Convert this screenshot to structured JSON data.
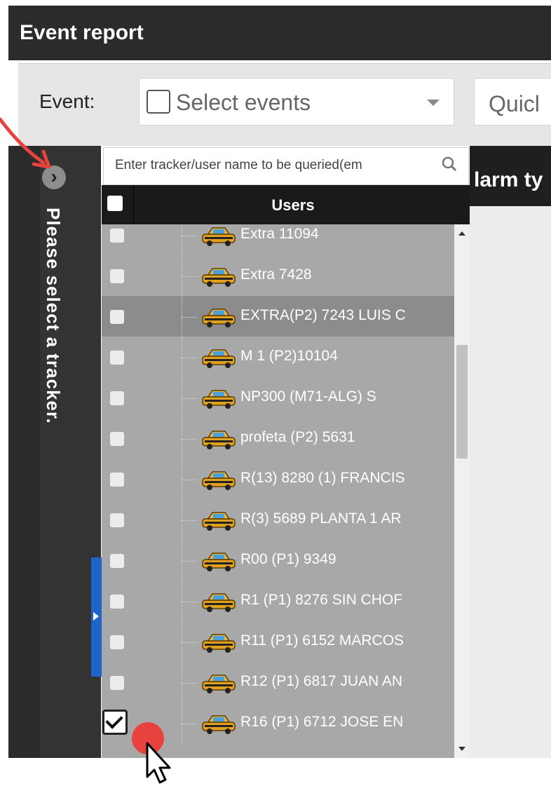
{
  "window": {
    "title": "Event report"
  },
  "filter": {
    "event_label": "Event:",
    "select_events_placeholder": "Select events",
    "quick_label": "Quicl"
  },
  "sidebar": {
    "vertical_text": "Please select a tracker."
  },
  "grid": {
    "header_partial": "larm ty"
  },
  "tree": {
    "search_placeholder": "Enter tracker/user name to be queried(em",
    "users_header": "Users",
    "rows": [
      {
        "name": "Extra 11094",
        "checked": false,
        "selected": false
      },
      {
        "name": "Extra 7428",
        "checked": false,
        "selected": false
      },
      {
        "name": "EXTRA(P2) 7243 LUIS C",
        "checked": false,
        "selected": true
      },
      {
        "name": "M 1 (P2)10104",
        "checked": false,
        "selected": false
      },
      {
        "name": "NP300 (M71-ALG) S",
        "checked": false,
        "selected": false
      },
      {
        "name": "profeta (P2) 5631",
        "checked": false,
        "selected": false
      },
      {
        "name": "R(13) 8280 (1) FRANCIS",
        "checked": false,
        "selected": false
      },
      {
        "name": "R(3) 5689 PLANTA 1 AR",
        "checked": false,
        "selected": false
      },
      {
        "name": "R00 (P1) 9349",
        "checked": false,
        "selected": false
      },
      {
        "name": "R1 (P1) 8276 SIN CHOF",
        "checked": false,
        "selected": false
      },
      {
        "name": "R11 (P1) 6152 MARCOS",
        "checked": false,
        "selected": false
      },
      {
        "name": "R12 (P1) 6817 JUAN AN",
        "checked": false,
        "selected": false
      },
      {
        "name": "R16 (P1) 6712 JOSE EN",
        "checked": true,
        "selected": false
      }
    ]
  },
  "icons": {
    "expand": "chevron-right-icon",
    "search": "search-icon",
    "vehicle": "taxi-car-icon"
  },
  "colors": {
    "dark": "#2b2b2b",
    "list_bg": "#a8a8a8",
    "selected_row": "#8c8c8c",
    "accent_blue": "#1f64c8",
    "annotation_red": "#e8423e"
  }
}
